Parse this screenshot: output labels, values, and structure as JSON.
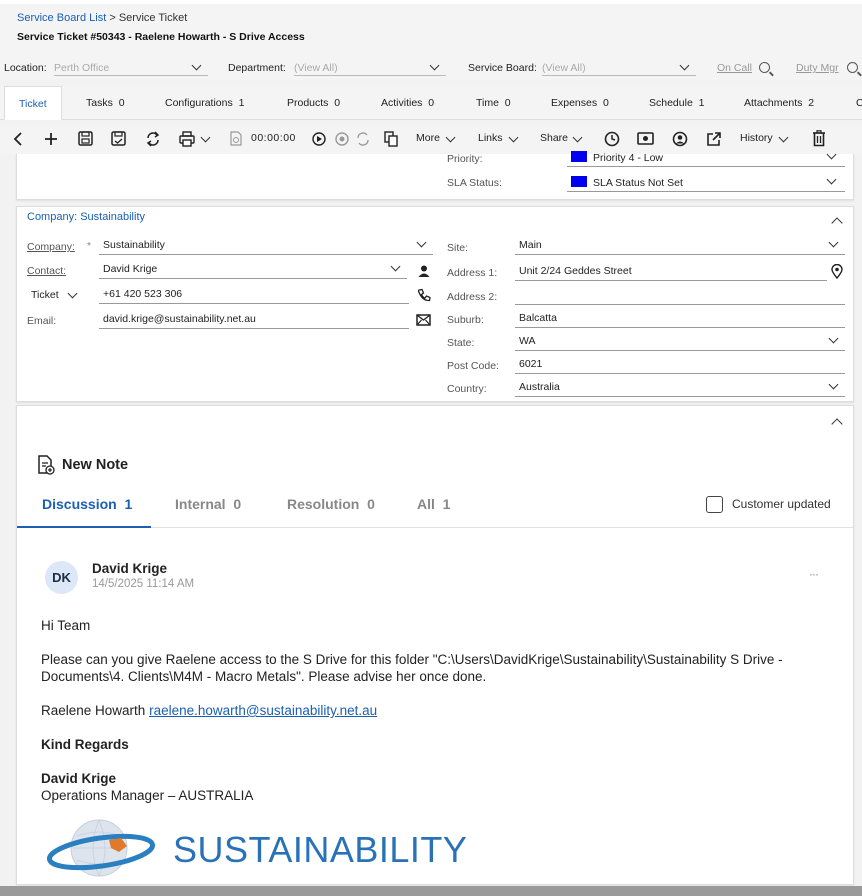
{
  "breadcrumb": {
    "parent": "Service Board List",
    "separator": ">",
    "current": "Service Ticket"
  },
  "ticket_title": "Service Ticket #50343 - Raelene Howarth - S Drive Access",
  "filters": {
    "location_label": "Location:",
    "location_value": "Perth Office",
    "department_label": "Department:",
    "department_value": "(View All)",
    "board_label": "Service Board:",
    "board_value": "(View All)",
    "oncall_link": "On Call",
    "dutymgr_link": "Duty Mgr"
  },
  "tabs": [
    {
      "label": "Ticket",
      "count": ""
    },
    {
      "label": "Tasks",
      "count": "0"
    },
    {
      "label": "Configurations",
      "count": "1"
    },
    {
      "label": "Products",
      "count": "0"
    },
    {
      "label": "Activities",
      "count": "0"
    },
    {
      "label": "Time",
      "count": "0"
    },
    {
      "label": "Expenses",
      "count": "0"
    },
    {
      "label": "Schedule",
      "count": "1"
    },
    {
      "label": "Attachments",
      "count": "2"
    },
    {
      "label": "C",
      "count": ""
    }
  ],
  "toolbar": {
    "timer": "00:00:00",
    "more": "More",
    "links": "Links",
    "share": "Share",
    "history": "History"
  },
  "priority": {
    "label": "Priority:",
    "value": "Priority 4 - Low",
    "color": "#0000ee"
  },
  "sla": {
    "label": "SLA Status:",
    "value": "SLA Status Not Set",
    "color": "#0000ee"
  },
  "company_section": {
    "header": "Company: Sustainability",
    "company_label": "Company:",
    "required": "*",
    "company_value": "Sustainability",
    "contact_label": "Contact:",
    "contact_value": "David Krige",
    "phone_type": "Ticket",
    "phone_value": "+61 420 523 306",
    "email_label": "Email:",
    "email_value": "david.krige@sustainability.net.au",
    "site_label": "Site:",
    "site_value": "Main",
    "address1_label": "Address 1:",
    "address1_value": "Unit 2/24 Geddes Street",
    "address2_label": "Address 2:",
    "address2_value": "",
    "suburb_label": "Suburb:",
    "suburb_value": "Balcatta",
    "state_label": "State:",
    "state_value": "WA",
    "postcode_label": "Post Code:",
    "postcode_value": "6021",
    "country_label": "Country:",
    "country_value": "Australia"
  },
  "notes": {
    "new_note": "New Note",
    "tabs": [
      {
        "label": "Discussion",
        "count": "1"
      },
      {
        "label": "Internal",
        "count": "0"
      },
      {
        "label": "Resolution",
        "count": "0"
      },
      {
        "label": "All",
        "count": "1"
      }
    ],
    "customer_updated": "Customer updated",
    "note": {
      "initials": "DK",
      "author": "David Krige",
      "timestamp": "14/5/2025 11:14 AM",
      "more": "···",
      "greeting": "Hi Team",
      "body_line1": "Please can you give Raelene access to the S Drive for this folder \"C:\\Users\\DavidKrige\\Sustainability\\Sustainability S Drive -",
      "body_line2": "Documents\\4. Clients\\M4M - Macro Metals\". Please advise her once done.",
      "contact_name": "Raelene Howarth",
      "contact_email": "raelene.howarth@sustainability.net.au",
      "regards": "Kind Regards",
      "sig_name": "David Krige",
      "sig_title": "Operations Manager – AUSTRALIA",
      "logo_text": "SUSTAINABILITY"
    }
  },
  "colors": {
    "accent": "#1a5fb4",
    "priority_square": "#0000ee"
  }
}
